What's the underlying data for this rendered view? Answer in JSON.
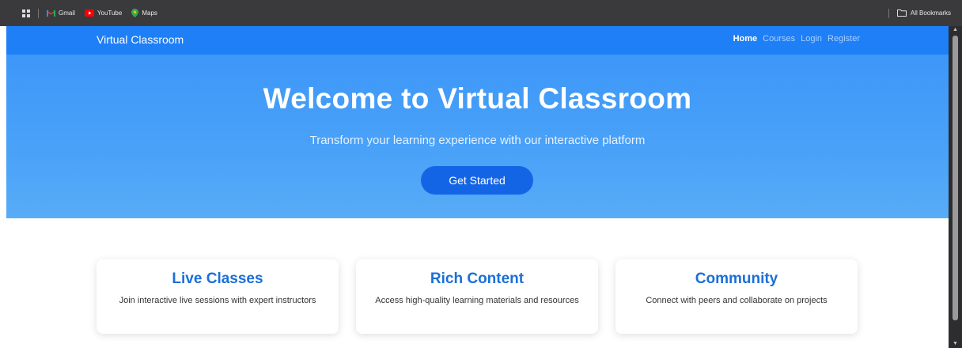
{
  "browser": {
    "bookmarks": [
      {
        "label": "Gmail",
        "icon": "gmail-icon"
      },
      {
        "label": "YouTube",
        "icon": "youtube-icon"
      },
      {
        "label": "Maps",
        "icon": "maps-icon"
      }
    ],
    "all_bookmarks_label": "All Bookmarks"
  },
  "nav": {
    "brand": "Virtual Classroom",
    "links": [
      {
        "label": "Home",
        "active": true
      },
      {
        "label": "Courses",
        "active": false
      },
      {
        "label": "Login",
        "active": false
      },
      {
        "label": "Register",
        "active": false
      }
    ]
  },
  "hero": {
    "title": "Welcome to Virtual Classroom",
    "subtitle": "Transform your learning experience with our interactive platform",
    "cta_label": "Get Started"
  },
  "features": [
    {
      "title": "Live Classes",
      "description": "Join interactive live sessions with expert instructors"
    },
    {
      "title": "Rich Content",
      "description": "Access high-quality learning materials and resources"
    },
    {
      "title": "Community",
      "description": "Connect with peers and collaborate on projects"
    }
  ],
  "colors": {
    "nav_bg": "#1e7ff7",
    "hero_bg": "#4aa2f8",
    "cta_bg": "#1465e6",
    "card_title": "#1b6fd8"
  }
}
